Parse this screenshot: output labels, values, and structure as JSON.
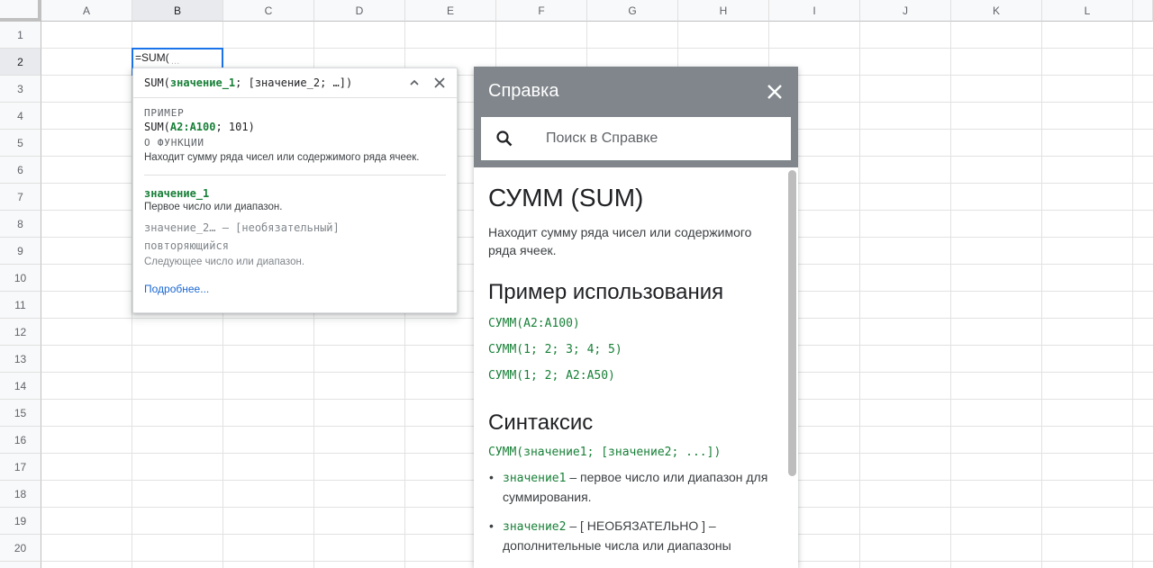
{
  "sheet": {
    "columns": [
      "A",
      "B",
      "C",
      "D",
      "E",
      "F",
      "G",
      "H",
      "I",
      "J",
      "K",
      "L"
    ],
    "rows": [
      "1",
      "2",
      "3",
      "4",
      "5",
      "6",
      "7",
      "8",
      "9",
      "10",
      "11",
      "12",
      "13",
      "14",
      "15",
      "16",
      "17",
      "18",
      "19",
      "20"
    ],
    "active_column": "B",
    "active_row": "2",
    "cell_input": "=SUM(",
    "cell_hint": "…"
  },
  "formula_helper": {
    "func_open": "SUM(",
    "arg1": "значение_1",
    "rest": "; [значение_2; …])",
    "example_label": "ПРИМЕР",
    "example_func": "SUM(",
    "example_arg": "A2:A100",
    "example_rest": "; 101)",
    "about_label": "О ФУНКЦИИ",
    "about_text": "Находит сумму ряда чисел или содержимого ряда ячеек.",
    "arg1_name": "значение_1",
    "arg1_desc": "Первое число или диапазон.",
    "arg2_name": "значение_2… – [необязательный]",
    "arg2_tag": "повторяющийся",
    "arg2_desc": "Следующее число или диапазон.",
    "more_link": "Подробнее...",
    "collapse_icon": "chevron-up-icon",
    "close_icon": "close-icon"
  },
  "help_panel": {
    "title": "Справка",
    "search_placeholder": "Поиск в Справке",
    "heading": "СУММ (SUM)",
    "description": "Находит сумму ряда чисел или содержимого ряда ячеек.",
    "usage_heading": "Пример использования",
    "usage_examples": [
      "СУММ(A2:A100)",
      "СУММ(1; 2; 3; 4; 5)",
      "СУММ(1; 2; A2:A50)"
    ],
    "syntax_heading": "Синтаксис",
    "syntax": "СУММ(значение1; [значение2; ...])",
    "params": [
      {
        "name": "значение1",
        "text": " – первое число или диапазон для суммирования."
      },
      {
        "name": "значение2",
        "text": " – [ НЕОБЯЗАТЕЛЬНО ] – дополнительные числа или диапазоны"
      }
    ]
  },
  "colors": {
    "accent": "#1a73e8",
    "function_green": "#188038",
    "help_header": "#80868b",
    "link": "#1967d2"
  }
}
